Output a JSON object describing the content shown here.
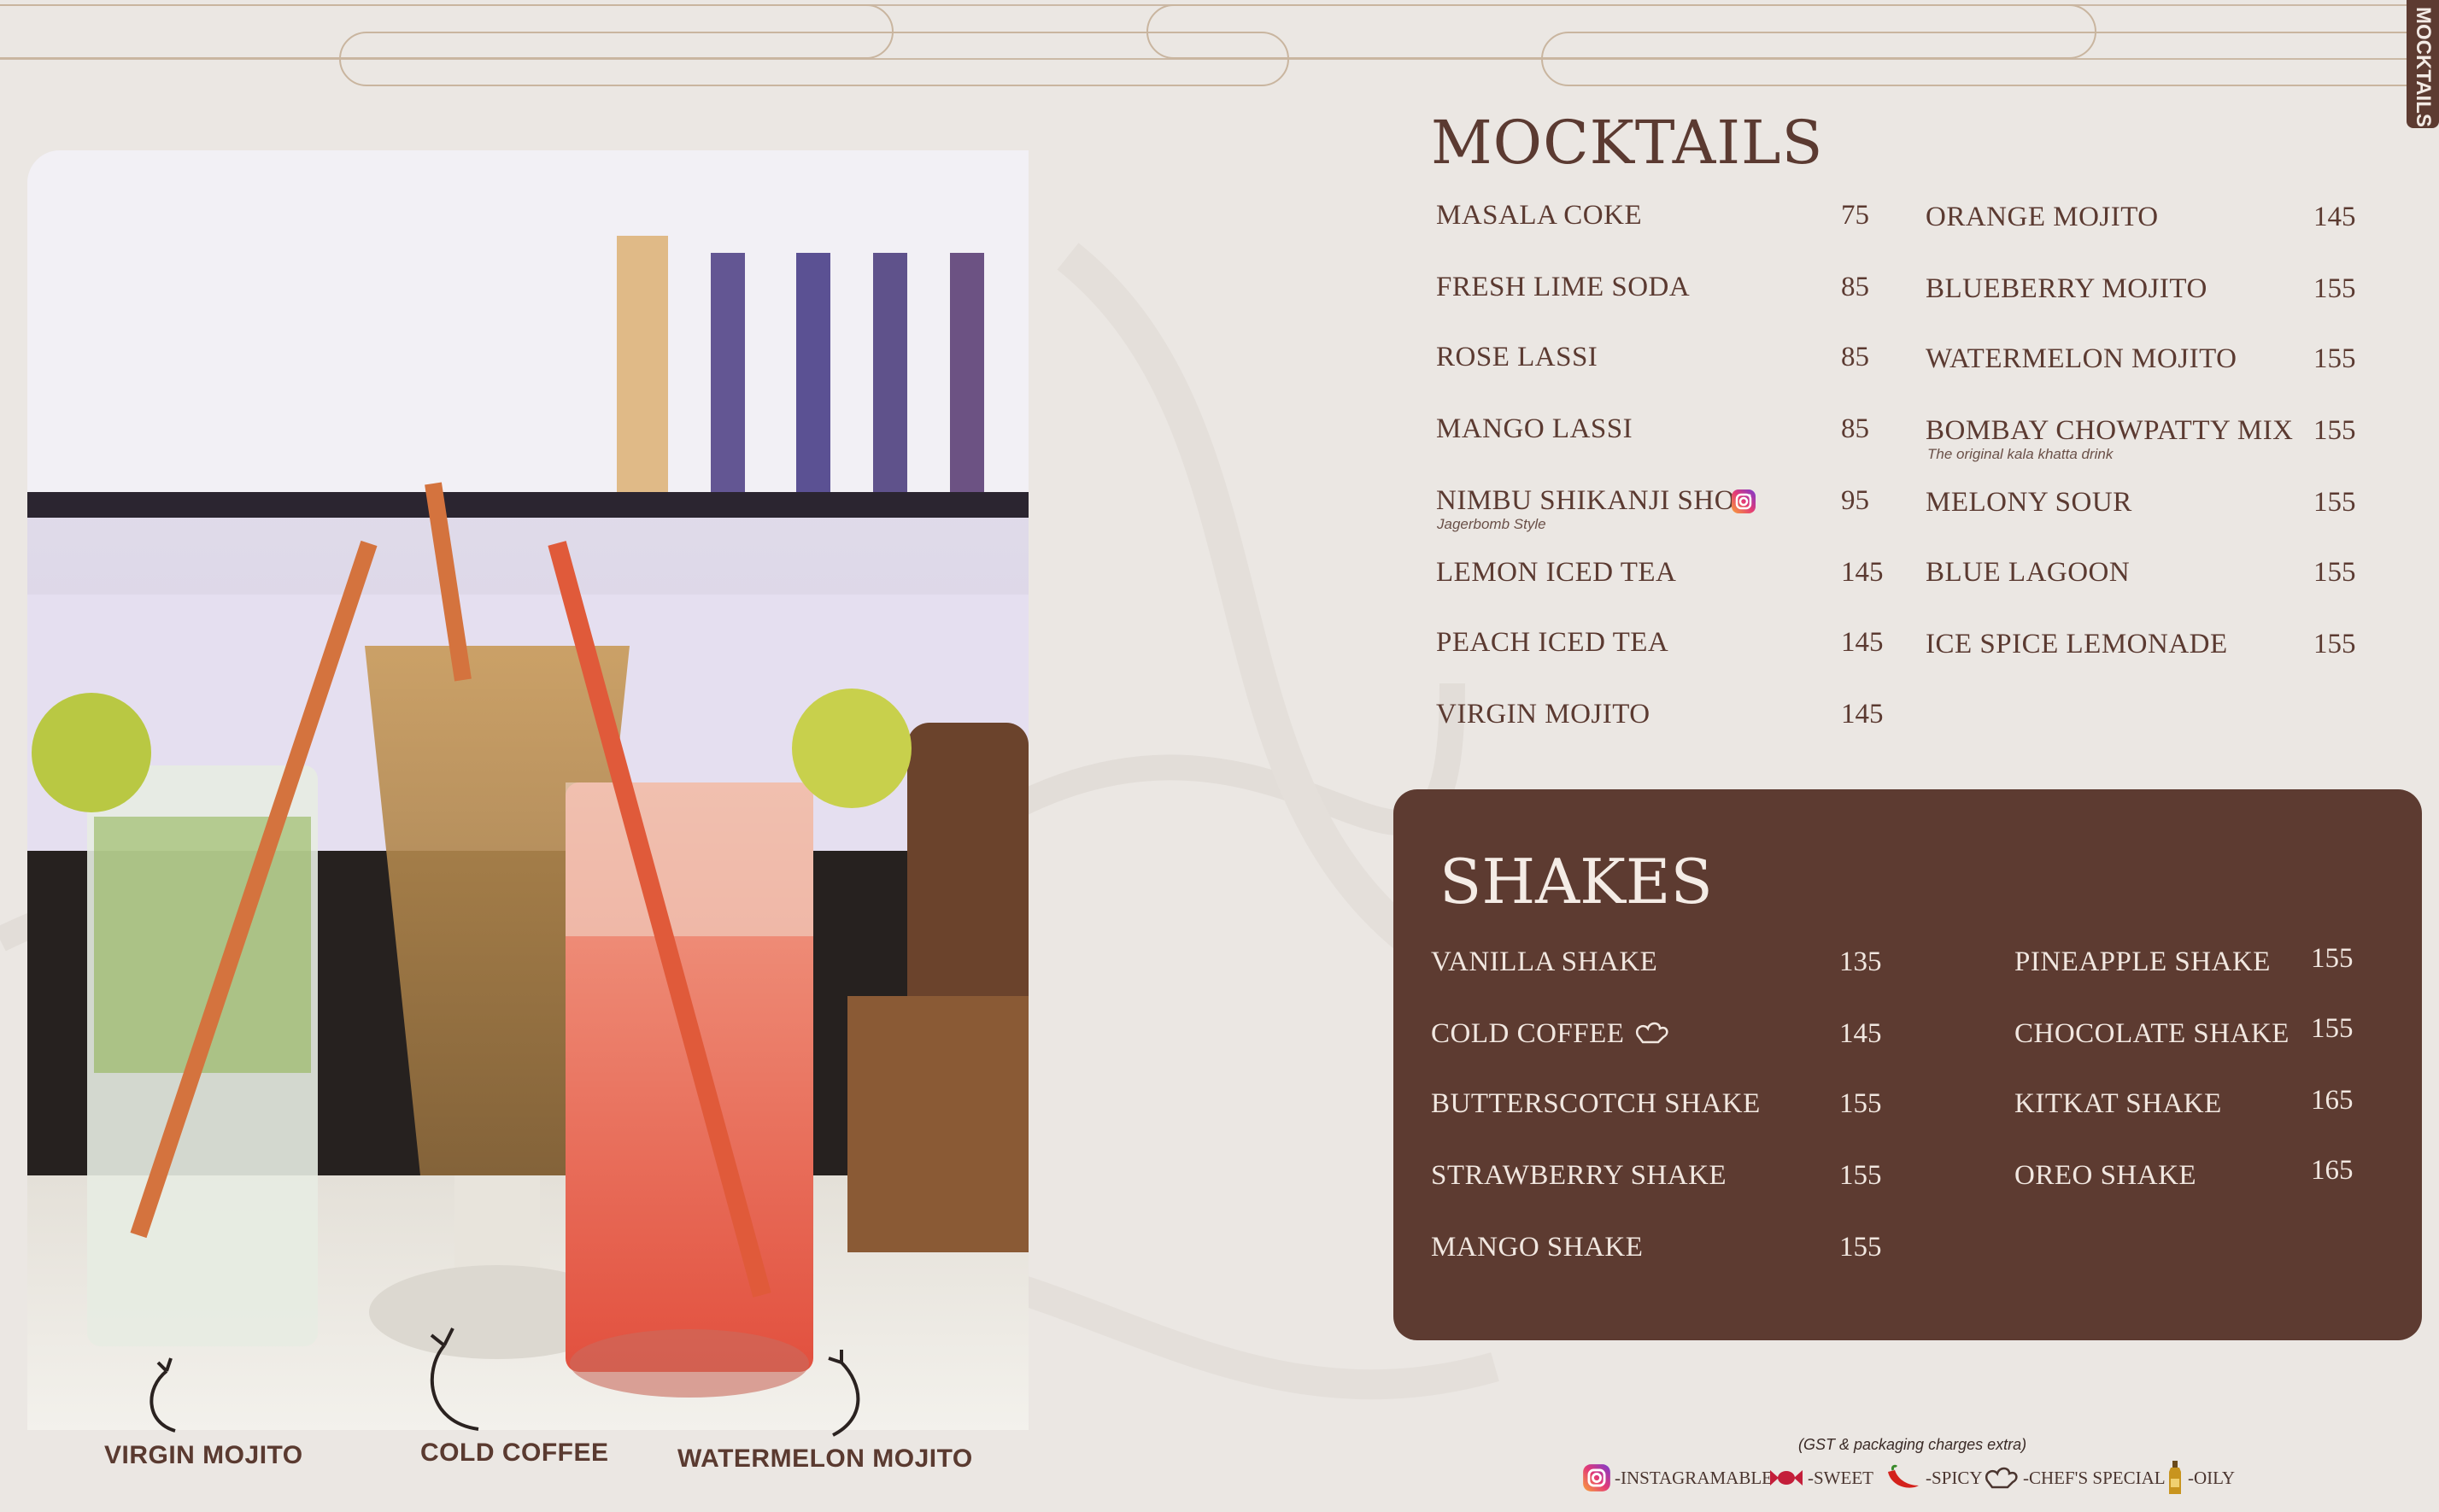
{
  "side_tab": "MOCKTAILS",
  "photo": {
    "captions": [
      "VIRGIN MOJITO",
      "COLD COFFEE",
      "WATERMELON MOJITO"
    ]
  },
  "mocktails": {
    "title": "MOCKTAILS",
    "left": [
      {
        "name": "MASALA COKE",
        "price": "75"
      },
      {
        "name": "FRESH LIME SODA",
        "price": "85"
      },
      {
        "name": "ROSE LASSI",
        "price": "85"
      },
      {
        "name": "MANGO LASSI",
        "price": "85"
      },
      {
        "name": "NIMBU SHIKANJI SHOT",
        "price": "95",
        "note": "Jagerbomb Style",
        "icon": "instagramable-icon"
      },
      {
        "name": "LEMON ICED TEA",
        "price": "145"
      },
      {
        "name": "PEACH ICED TEA",
        "price": "145"
      },
      {
        "name": "VIRGIN MOJITO",
        "price": "145"
      }
    ],
    "right": [
      {
        "name": "ORANGE MOJITO",
        "price": "145"
      },
      {
        "name": "BLUEBERRY MOJITO",
        "price": "155"
      },
      {
        "name": "WATERMELON MOJITO",
        "price": "155"
      },
      {
        "name": "BOMBAY CHOWPATTY MIX",
        "price": "155",
        "note": "The original kala khatta drink"
      },
      {
        "name": "MELONY SOUR",
        "price": "155"
      },
      {
        "name": "BLUE LAGOON",
        "price": "155"
      },
      {
        "name": "ICE SPICE LEMONADE",
        "price": "155"
      }
    ]
  },
  "shakes": {
    "title": "SHAKES",
    "left": [
      {
        "name": "VANILLA SHAKE",
        "price": "135"
      },
      {
        "name": "COLD COFFEE",
        "price": "145",
        "icon": "chefs-special-icon"
      },
      {
        "name": "BUTTERSCOTCH SHAKE",
        "price": "155"
      },
      {
        "name": "STRAWBERRY SHAKE",
        "price": "155"
      },
      {
        "name": "MANGO SHAKE",
        "price": "155"
      }
    ],
    "right": [
      {
        "name": "PINEAPPLE SHAKE",
        "price": "155"
      },
      {
        "name": "CHOCOLATE SHAKE",
        "price": "155"
      },
      {
        "name": "KITKAT SHAKE",
        "price": "165"
      },
      {
        "name": "OREO SHAKE",
        "price": "165"
      }
    ]
  },
  "footer": {
    "note": "(GST & packaging charges extra)",
    "legend": [
      {
        "icon": "instagramable-icon",
        "label": "-INSTAGRAMABLE"
      },
      {
        "icon": "sweet-icon",
        "label": "-SWEET"
      },
      {
        "icon": "spicy-icon",
        "label": "-SPICY"
      },
      {
        "icon": "chefs-special-icon",
        "label": "-CHEF'S SPECIAL"
      },
      {
        "icon": "oily-icon",
        "label": "-OILY"
      }
    ]
  },
  "colors": {
    "brand_brown": "#5d3b31",
    "background": "#ebe7e3",
    "text_light": "#f1e7e0"
  }
}
